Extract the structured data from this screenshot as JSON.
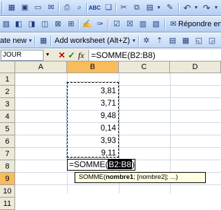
{
  "toolbar_standard": {
    "icons": [
      "excel-doc-icon",
      "save-icon",
      "open-icon",
      "email-icon",
      "print-icon",
      "print-preview-icon",
      "spelling-icon",
      "research-icon",
      "cut-icon",
      "copy-icon",
      "paste-icon",
      "format-painter-icon",
      "undo-icon",
      "redo-icon"
    ]
  },
  "toolbar_reviewing": {
    "reply_label": "Répondre en in"
  },
  "toolbar_addin": {
    "new_label": "ate new",
    "add_worksheet_label": "Add worksheet (Alt+Z)"
  },
  "formula_bar": {
    "name_box": "JOUR",
    "cancel_glyph": "✕",
    "enter_glyph": "✓",
    "fx_glyph": "fx",
    "formula": "=SOMME(B2:B8)"
  },
  "sheet": {
    "columns": [
      "A",
      "B",
      "C",
      "D"
    ],
    "rows": [
      "1",
      "2",
      "3",
      "4",
      "5",
      "6",
      "7",
      "8",
      "9",
      "10",
      "11"
    ],
    "selected_column": "B",
    "selected_row": "9",
    "b_values": [
      "3,81",
      "3,71",
      "9,48",
      "0,14",
      "3,93",
      "9,11"
    ],
    "edit_prefix": "=SOMME(",
    "edit_range": "B2:B8",
    "edit_suffix": ")"
  },
  "tooltip": {
    "func": "SOMME(",
    "arg1": "nombre1",
    "rest": "; [nombre2]; ...)"
  },
  "colors": {
    "toolbar_blue": "#c2d7f5",
    "header_gray": "#ece9d8",
    "selected_header_orange": "#f8bc5a",
    "tooltip_yellow": "#ffffe1"
  }
}
